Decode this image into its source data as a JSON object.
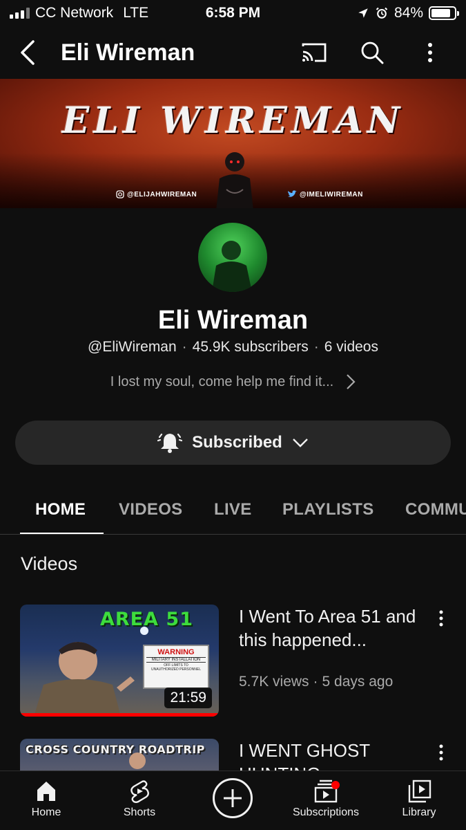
{
  "status_bar": {
    "carrier": "CC Network",
    "network": "LTE",
    "time": "6:58 PM",
    "battery": "84%",
    "battery_fraction": 0.84
  },
  "header": {
    "title": "Eli Wireman",
    "icons": [
      "back-arrow-icon",
      "cast-icon",
      "search-icon",
      "more-vert-icon"
    ]
  },
  "banner": {
    "title": "ELI WIREMAN",
    "instagram_handle": "@ELIJAHWIREMAN",
    "twitter_handle": "@IMELIWIREMAN",
    "colors": {
      "primary": "#b33a17",
      "dark": "#3d0b04"
    }
  },
  "channel": {
    "name": "Eli Wireman",
    "handle": "@EliWireman",
    "subscribers": "45.9K subscribers",
    "videos": "6 videos",
    "description": "I lost my soul, come help me find it..."
  },
  "subscribe_button": {
    "label": "Subscribed"
  },
  "tabs": [
    {
      "label": "HOME",
      "active": true
    },
    {
      "label": "VIDEOS",
      "active": false
    },
    {
      "label": "LIVE",
      "active": false
    },
    {
      "label": "PLAYLISTS",
      "active": false
    },
    {
      "label": "COMMUNITY",
      "active": false
    }
  ],
  "section": {
    "title": "Videos"
  },
  "videos": [
    {
      "title": "I Went To Area 51 and this happened...",
      "views": "5.7K views",
      "age": "5 days ago",
      "duration": "21:59",
      "thumbnail_text": "AREA 51",
      "sign_heading": "WARNING",
      "sign_sub": "MILITARY INSTALLATION",
      "sign_line1": "OFF LIMITS TO",
      "sign_line2": "UNAUTHORIZED PERSONNEL",
      "watched_fraction": 1.0
    },
    {
      "title": "I WENT GHOST HUNTING",
      "thumbnail_text": "CROSS COUNTRY ROADTRIP"
    }
  ],
  "bottom_nav": [
    {
      "label": "Home"
    },
    {
      "label": "Shorts"
    },
    {
      "label": ""
    },
    {
      "label": "Subscriptions"
    },
    {
      "label": "Library"
    }
  ],
  "accent_colors": {
    "red": "#ff0000",
    "background": "#0f0f0f",
    "chip": "#272727"
  }
}
